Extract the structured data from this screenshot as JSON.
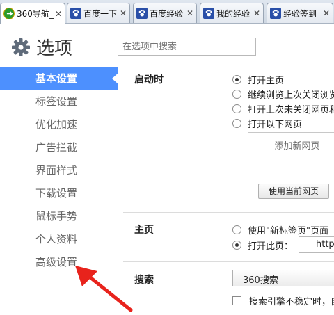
{
  "tabs": [
    {
      "label": "360导航_",
      "icon": "360-nav-icon"
    },
    {
      "label": "百度一下",
      "icon": "baidu-paw-icon"
    },
    {
      "label": "百度经验",
      "icon": "baidu-paw-icon"
    },
    {
      "label": "我的经验",
      "icon": "baidu-paw-icon"
    },
    {
      "label": "经验签到",
      "icon": "baidu-paw-icon"
    }
  ],
  "tab_close": "✕",
  "header": {
    "title": "选项",
    "search_placeholder": "在选项中搜索"
  },
  "sidebar": {
    "items": [
      {
        "label": "基本设置",
        "active": true
      },
      {
        "label": "标签设置"
      },
      {
        "label": "优化加速"
      },
      {
        "label": "广告拦截"
      },
      {
        "label": "界面样式"
      },
      {
        "label": "下载设置"
      },
      {
        "label": "鼠标手势"
      },
      {
        "label": "个人资料"
      },
      {
        "label": "高级设置"
      }
    ]
  },
  "startup": {
    "label": "启动时",
    "options": [
      {
        "label": "打开主页",
        "selected": true
      },
      {
        "label": "继续浏览上次关闭浏览"
      },
      {
        "label": "打开上次未关闭网页和"
      },
      {
        "label": "打开以下网页"
      }
    ],
    "add_page": "添加新网页",
    "use_current_button": "使用当前网页"
  },
  "homepage": {
    "label": "主页",
    "options": [
      {
        "label": "使用\"新标签页\"页面"
      },
      {
        "label": "打开此页：",
        "selected": true
      }
    ],
    "url_value": "http:"
  },
  "search": {
    "label": "搜索",
    "engine_value": "360搜索",
    "unstable_checkbox_label": "搜索引擎不稳定时，自"
  },
  "colors": {
    "sidebar_active": "#4d90fe",
    "annotation_arrow": "#e8231c"
  }
}
